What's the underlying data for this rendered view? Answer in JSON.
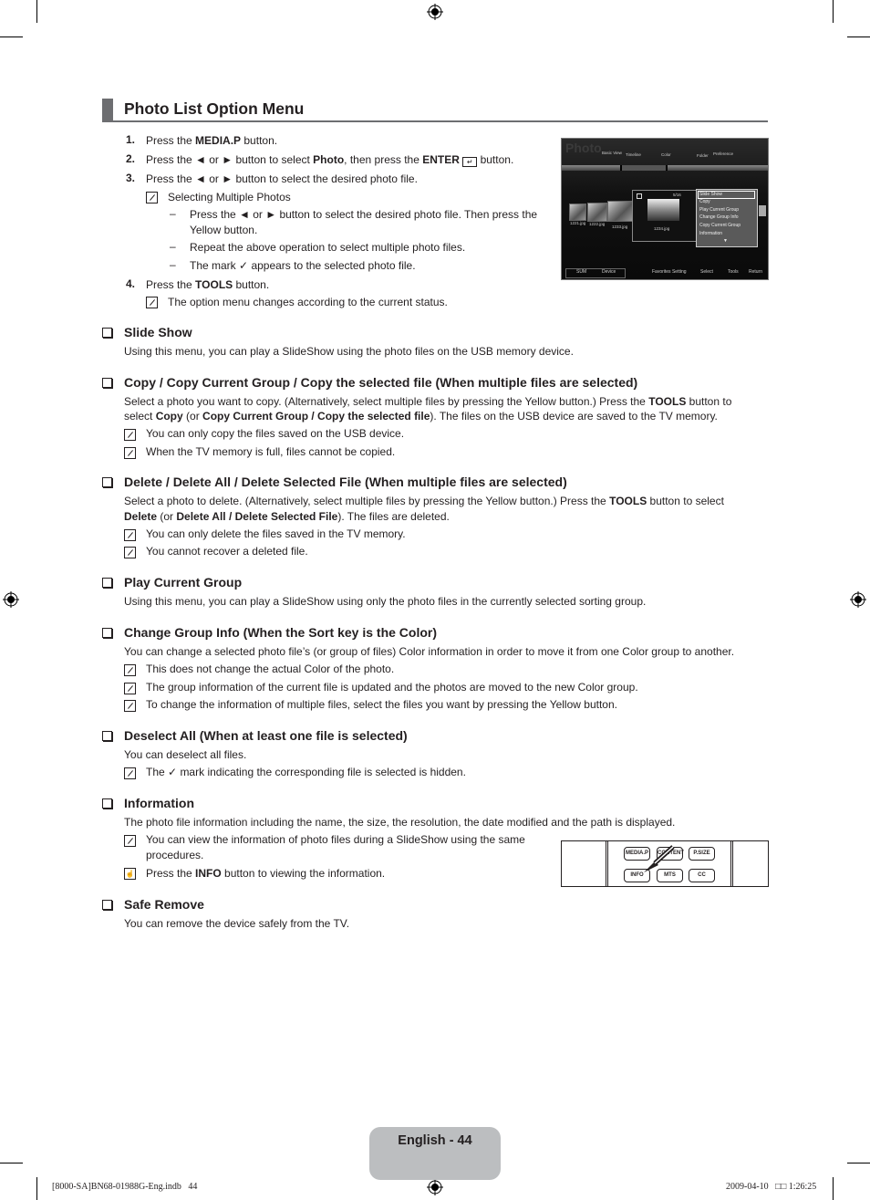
{
  "page": {
    "title": "Photo List Option Menu",
    "page_label": "English - 44",
    "footer_left": "[8000-SA]BN68-01988G-Eng.indb   44",
    "footer_right": "2009-04-10   □□ 1:26:25"
  },
  "steps": [
    {
      "num": "1.",
      "parts": [
        "Press the ",
        "MEDIA.P",
        " button."
      ]
    },
    {
      "num": "2.",
      "parts": [
        "Press the ◄ or ► button to select ",
        "Photo",
        ", then press the ",
        "ENTER",
        " button."
      ]
    },
    {
      "num": "3.",
      "text": "Press the ◄ or ► button to select the desired photo file."
    },
    {
      "num": "4.",
      "parts": [
        "Press the ",
        "TOOLS",
        " button."
      ]
    }
  ],
  "step3_note": "Selecting Multiple Photos",
  "step3_dashes": [
    "Press the ◄ or ► button to select the desired photo file. Then press the",
    "Yellow button.",
    "Repeat the above operation to select multiple photo files.",
    "The mark",
    "appears to the selected photo file."
  ],
  "step4_note": "The option menu changes according to the current status.",
  "tv_screen": {
    "title": "Photo",
    "tabs": [
      "Basic View",
      "Timeline",
      "Color",
      "Folder",
      "Preference"
    ],
    "thumbs": [
      "1221.jpg",
      "1222.jpg",
      "1233.jpg"
    ],
    "selected_file": "1234.jpg",
    "counter": "5/16",
    "menu_items": [
      "Slide Show",
      "Copy",
      "Play Current Group",
      "Change Group Info",
      "Copy Current Group",
      "Information"
    ],
    "footer_left": [
      "SUM",
      "Device"
    ],
    "footer_right": [
      "Favorites Setting",
      "Select",
      "Tools",
      "Return"
    ]
  },
  "sections": [
    {
      "heading": "Slide Show",
      "body": [
        "Using this menu, you can play a SlideShow using the photo files on the USB memory device."
      ],
      "notes": []
    },
    {
      "heading": "Copy / Copy Current Group / Copy the selected file (When multiple files are selected)",
      "body_parts": [
        [
          "Select a photo you want to copy. (Alternatively, select multiple files by pressing the Yellow button.) Press the ",
          "TOOLS",
          " button to"
        ],
        [
          "select ",
          "Copy",
          " (or ",
          "Copy Current Group / Copy the selected file",
          "). The files on the USB device are saved to the TV memory."
        ]
      ],
      "notes": [
        "You can only copy the files saved on the USB device.",
        "When the TV memory is full, files cannot be copied."
      ]
    },
    {
      "heading": "Delete / Delete All / Delete Selected File (When multiple files are selected)",
      "body_parts": [
        [
          "Select a photo to delete. (Alternatively, select multiple files by pressing the Yellow button.) Press the ",
          "TOOLS",
          " button to select"
        ],
        [
          "",
          "Delete",
          " (or ",
          "Delete All / Delete Selected File",
          "). The files are deleted."
        ]
      ],
      "notes": [
        "You can only delete the files saved in the TV memory.",
        "You cannot recover a deleted file."
      ]
    },
    {
      "heading": "Play Current Group",
      "body": [
        "Using this menu, you can play a SlideShow using only the photo files in the currently selected sorting group."
      ],
      "notes": []
    },
    {
      "heading": "Change Group Info (When the Sort key is the Color)",
      "body": [
        "You can change a selected photo file’s (or group of files) Color information in order to move it from one Color group to another."
      ],
      "notes": [
        "This does not change the actual Color of the photo.",
        "The group information of the current file is updated and the photos are moved to the new Color group.",
        "To change the information of multiple files, select the files you want by pressing the Yellow button."
      ]
    },
    {
      "heading": "Deselect All (When at least one file is selected)",
      "body": [
        "You can deselect all files."
      ],
      "notes": [
        "The",
        "mark indicating the corresponding file is selected is hidden."
      ]
    },
    {
      "heading": "Information",
      "body": [
        "The photo file information including the name, the size, the resolution, the date modified and the path is displayed."
      ],
      "notes": [
        "You can view the information of photo files during a SlideShow using the same",
        "procedures."
      ],
      "remote_note_parts": [
        "Press the ",
        "INFO",
        " button to viewing the information."
      ]
    },
    {
      "heading": "Safe Remove",
      "body": [
        "You can remove the device safely from the TV."
      ],
      "notes": []
    }
  ],
  "remote": {
    "buttons": [
      "MEDIA.P",
      "CONTENT",
      "P.SIZE",
      "INFO",
      "MTS",
      "CC"
    ]
  }
}
